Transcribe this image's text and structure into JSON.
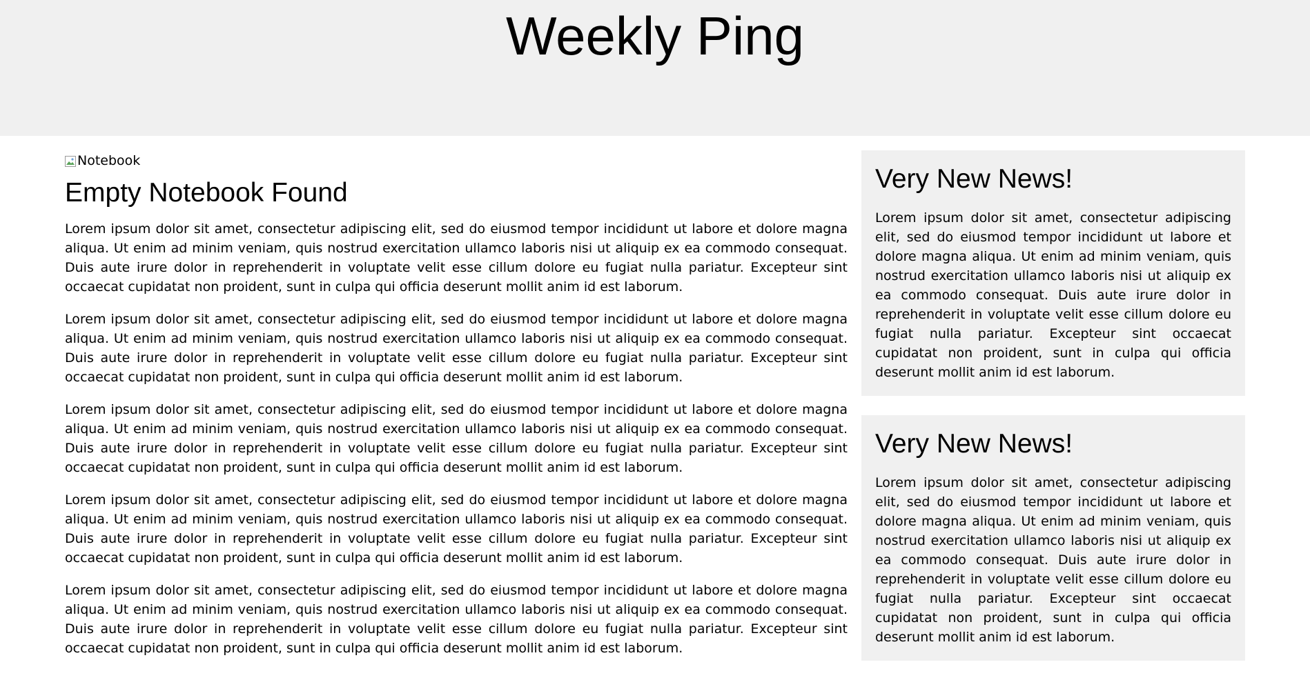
{
  "header": {
    "title": "Weekly Ping"
  },
  "main": {
    "image_alt": "Notebook",
    "heading": "Empty Notebook Found",
    "paragraphs": [
      "Lorem ipsum dolor sit amet, consectetur adipiscing elit, sed do eiusmod tempor incididunt ut labore et dolore magna aliqua. Ut enim ad minim veniam, quis nostrud exercitation ullamco laboris nisi ut aliquip ex ea commodo consequat. Duis aute irure dolor in reprehenderit in voluptate velit esse cillum dolore eu fugiat nulla pariatur. Excepteur sint occaecat cupidatat non proident, sunt in culpa qui officia deserunt mollit anim id est laborum.",
      "Lorem ipsum dolor sit amet, consectetur adipiscing elit, sed do eiusmod tempor incididunt ut labore et dolore magna aliqua. Ut enim ad minim veniam, quis nostrud exercitation ullamco laboris nisi ut aliquip ex ea commodo consequat. Duis aute irure dolor in reprehenderit in voluptate velit esse cillum dolore eu fugiat nulla pariatur. Excepteur sint occaecat cupidatat non proident, sunt in culpa qui officia deserunt mollit anim id est laborum.",
      "Lorem ipsum dolor sit amet, consectetur adipiscing elit, sed do eiusmod tempor incididunt ut labore et dolore magna aliqua. Ut enim ad minim veniam, quis nostrud exercitation ullamco laboris nisi ut aliquip ex ea commodo consequat. Duis aute irure dolor in reprehenderit in voluptate velit esse cillum dolore eu fugiat nulla pariatur. Excepteur sint occaecat cupidatat non proident, sunt in culpa qui officia deserunt mollit anim id est laborum.",
      "Lorem ipsum dolor sit amet, consectetur adipiscing elit, sed do eiusmod tempor incididunt ut labore et dolore magna aliqua. Ut enim ad minim veniam, quis nostrud exercitation ullamco laboris nisi ut aliquip ex ea commodo consequat. Duis aute irure dolor in reprehenderit in voluptate velit esse cillum dolore eu fugiat nulla pariatur. Excepteur sint occaecat cupidatat non proident, sunt in culpa qui officia deserunt mollit anim id est laborum.",
      "Lorem ipsum dolor sit amet, consectetur adipiscing elit, sed do eiusmod tempor incididunt ut labore et dolore magna aliqua. Ut enim ad minim veniam, quis nostrud exercitation ullamco laboris nisi ut aliquip ex ea commodo consequat. Duis aute irure dolor in reprehenderit in voluptate velit esse cillum dolore eu fugiat nulla pariatur. Excepteur sint occaecat cupidatat non proident, sunt in culpa qui officia deserunt mollit anim id est laborum."
    ]
  },
  "sidebar": {
    "cards": [
      {
        "title": "Very New News!",
        "body": "Lorem ipsum dolor sit amet, consectetur adipiscing elit, sed do eiusmod tempor incididunt ut labore et dolore magna aliqua. Ut enim ad minim veniam, quis nostrud exercitation ullamco laboris nisi ut aliquip ex ea commodo consequat. Duis aute irure dolor in reprehenderit in voluptate velit esse cillum dolore eu fugiat nulla pariatur. Excepteur sint occaecat cupidatat non proident, sunt in culpa qui officia deserunt mollit anim id est laborum."
      },
      {
        "title": "Very New News!",
        "body": "Lorem ipsum dolor sit amet, consectetur adipiscing elit, sed do eiusmod tempor incididunt ut labore et dolore magna aliqua. Ut enim ad minim veniam, quis nostrud exercitation ullamco laboris nisi ut aliquip ex ea commodo consequat. Duis aute irure dolor in reprehenderit in voluptate velit esse cillum dolore eu fugiat nulla pariatur. Excepteur sint occaecat cupidatat non proident, sunt in culpa qui officia deserunt mollit anim id est laborum."
      }
    ]
  },
  "colors": {
    "header_background": "#f0f0f0",
    "card_background": "#f0f0f0",
    "page_background": "#ffffff",
    "text": "#000000"
  }
}
